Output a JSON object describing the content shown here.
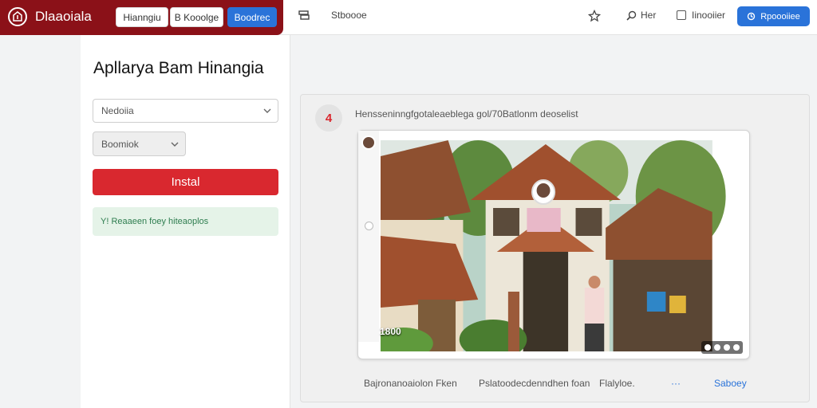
{
  "app": {
    "brand": "Dlaaoiala",
    "tabs": [
      "Hianngiu",
      "B Kooolge",
      "Boodrec"
    ],
    "toolbar": {
      "tool1": "Stboooe",
      "tool2": "Her",
      "checkbox_label": "Iinooiier",
      "action": "Rpoooiiee"
    }
  },
  "left_panel": {
    "title": "Apllarya Bam Hinangia",
    "select1": "Nedoiia",
    "select2": "Boomiok",
    "install_label": "Instal",
    "status": "Y! Reaaeen foey hiteaoplos"
  },
  "post": {
    "badge": "4",
    "text": "Hensseninngfgotaleaeblega gol/70Batlonm deoselist",
    "image_label": "1800",
    "footer": [
      "Bajronanoaiolon Fken",
      "Pslatoodecdenndhen foan",
      "Flalyloe.",
      "···",
      "Saboey"
    ]
  },
  "colors": {
    "brand": "#8b1118",
    "accent_blue": "#2a73d9",
    "install_red": "#d9282f",
    "status_green_bg": "#e5f3e8"
  }
}
